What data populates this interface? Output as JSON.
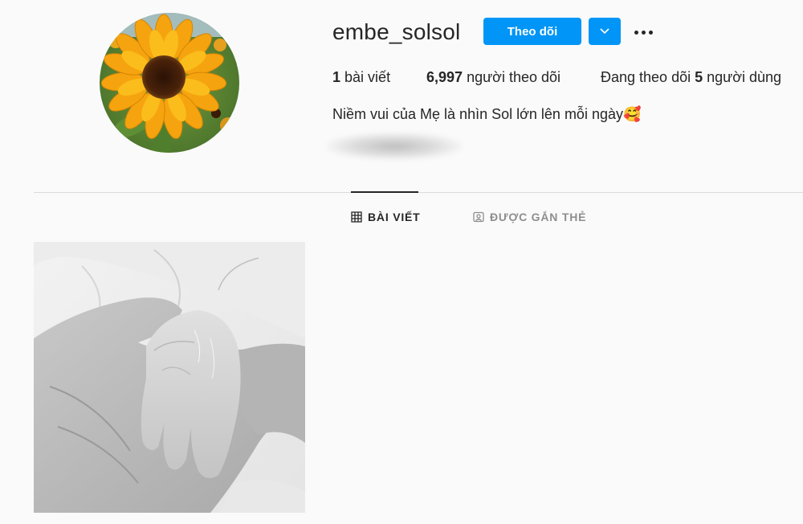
{
  "profile": {
    "username": "embe_solsol",
    "follow_label": "Theo dõi",
    "stats": {
      "posts_count": "1",
      "posts_label": "bài viết",
      "followers_count": "6,997",
      "followers_label": "người theo dõi",
      "following_prefix": "Đang theo dõi",
      "following_count": "5",
      "following_suffix": "người dùng"
    },
    "bio": "Niềm vui của Mẹ là nhìn Sol lớn lên mỗi ngày🥰"
  },
  "tabs": {
    "posts": "BÀI VIẾT",
    "tagged": "ĐƯỢC GẮN THẺ",
    "active": "posts"
  },
  "colors": {
    "accent": "#0095f6",
    "text": "#262626",
    "muted": "#8e8e8e",
    "background": "#fafafa",
    "divider": "#dbdbdb"
  },
  "icons": {
    "dropdown": "chevron-down-icon",
    "more": "more-options-icon",
    "posts_tab": "grid-icon",
    "tagged_tab": "tagged-user-icon"
  }
}
